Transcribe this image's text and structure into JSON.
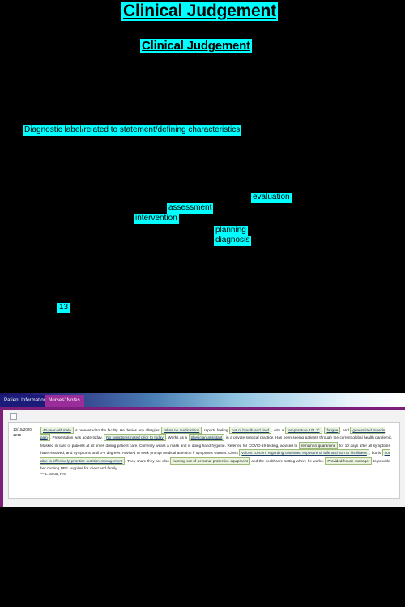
{
  "slide": {
    "title_main": "Clinical Judgement",
    "title_sub": "Clinical Judgement",
    "diagnostic_label": "Diagnostic label/related to statement/defining characteristics",
    "words": {
      "evaluation": "evaluation",
      "assessment": "assessment",
      "intervention": "intervention",
      "planning": "planning",
      "diagnosis": "diagnosis"
    },
    "slide_number": "13",
    "colors": {
      "background": "#000000",
      "highlight": "#00ffff",
      "text": "#000000"
    }
  },
  "ehr": {
    "tabs": [
      {
        "label": "Patient Information",
        "active": false,
        "color": "#1b1b7a"
      },
      {
        "label": "Nurses' Notes",
        "active": true,
        "color": "#9b2d9b"
      }
    ],
    "accent_color": "#7b1f7b",
    "note": {
      "date": "10/15/2020",
      "time": "1215",
      "segments": [
        {
          "text": "42-year-old male",
          "mark": "underline"
        },
        {
          "text": " is presented to the facility. He denies any allergies, ",
          "mark": "none"
        },
        {
          "text": "takes no medications",
          "mark": "underline"
        },
        {
          "text": ", reports feeling ",
          "mark": "none"
        },
        {
          "text": "out of breath and tired",
          "mark": "underline"
        },
        {
          "text": ", with a ",
          "mark": "none"
        },
        {
          "text": "temperature 101.3°",
          "mark": "underline"
        },
        {
          "text": ", ",
          "mark": "none"
        },
        {
          "text": "fatigue",
          "mark": "underline"
        },
        {
          "text": ", and ",
          "mark": "none"
        },
        {
          "text": "generalized muscle pain",
          "mark": "underline"
        },
        {
          "text": ". Presentation was acute today. ",
          "mark": "none"
        },
        {
          "text": "No symptoms noted prior to today",
          "mark": "underline"
        },
        {
          "text": ". Works as a ",
          "mark": "none"
        },
        {
          "text": "physician assistant",
          "mark": "underline"
        },
        {
          "text": " in a private surgical practice. Has been seeing patients through the current global health pandemic. ",
          "mark": "none"
        },
        {
          "text": "Masked in care of patients at all times during patient care",
          "mark": "none"
        },
        {
          "text": ". Currently wears a mask and is doing hand hygiene. Referred for COVID-19 testing, advised to ",
          "mark": "none"
        },
        {
          "text": "remain in quarantine",
          "mark": "plain"
        },
        {
          "text": " for 10 days after all symptoms have resolved, and symptoms until 0-0 degrees. Advised to seek prompt medical attention if symptoms worsen. Client ",
          "mark": "none"
        },
        {
          "text": "voices concern regarding continued exposure of wife and son to his illness",
          "mark": "underline"
        },
        {
          "text": ", but is ",
          "mark": "none"
        },
        {
          "text": "not able to effectively prioritize nutrition management",
          "mark": "underline"
        },
        {
          "text": ". They share they are also ",
          "mark": "none"
        },
        {
          "text": "running out of personal protective equipment",
          "mark": "plain"
        },
        {
          "text": " and the healthcare setting where he works. ",
          "mark": "none"
        },
        {
          "text": "Provided house manager",
          "mark": "plain"
        },
        {
          "text": " to provide her nursing PPE supplies for client and family.",
          "mark": "none"
        }
      ],
      "signature": "— L. Scott, RN"
    }
  }
}
